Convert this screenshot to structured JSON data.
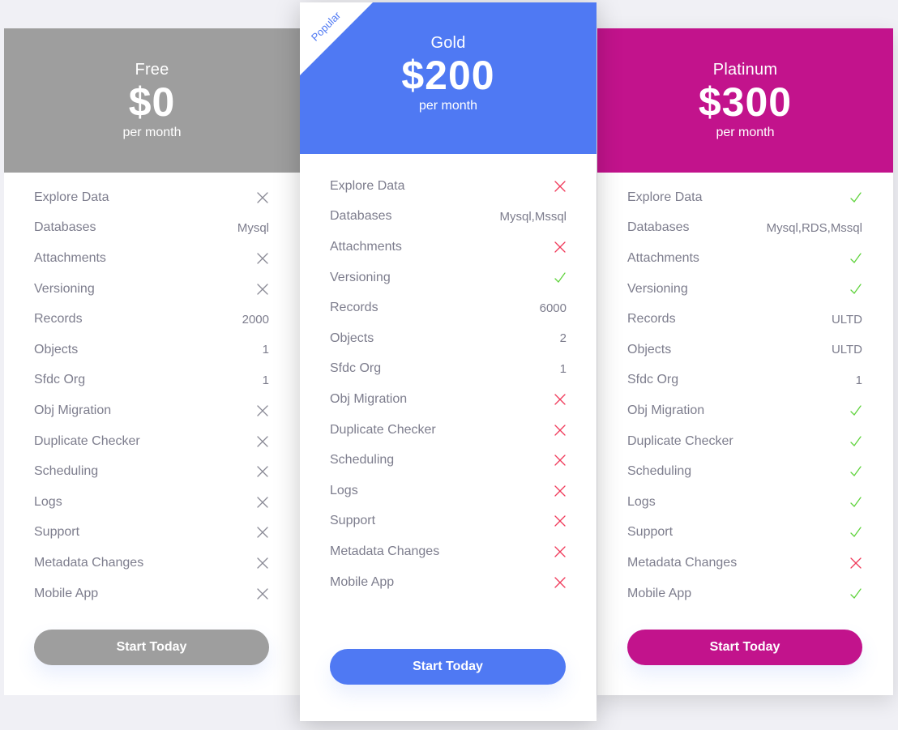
{
  "colors": {
    "free": "#9e9e9e",
    "gold": "#4f79f3",
    "platinum": "#c2138c",
    "check": "#5fd33c",
    "cross_red": "#f03a5a",
    "cross_gray": "#8a8a96"
  },
  "plans": [
    {
      "id": "free",
      "name": "Free",
      "price": "$0",
      "period": "per month",
      "badge": null,
      "cta": "Start Today",
      "features": [
        {
          "label": "Explore Data",
          "type": "cross"
        },
        {
          "label": "Databases",
          "type": "text",
          "value": "Mysql"
        },
        {
          "label": "Attachments",
          "type": "cross"
        },
        {
          "label": "Versioning",
          "type": "cross"
        },
        {
          "label": "Records",
          "type": "text",
          "value": "2000"
        },
        {
          "label": "Objects",
          "type": "text",
          "value": "1"
        },
        {
          "label": "Sfdc Org",
          "type": "text",
          "value": "1"
        },
        {
          "label": "Obj Migration",
          "type": "cross"
        },
        {
          "label": "Duplicate Checker",
          "type": "cross"
        },
        {
          "label": "Scheduling",
          "type": "cross"
        },
        {
          "label": "Logs",
          "type": "cross"
        },
        {
          "label": "Support",
          "type": "cross"
        },
        {
          "label": "Metadata Changes",
          "type": "cross"
        },
        {
          "label": "Mobile App",
          "type": "cross"
        }
      ]
    },
    {
      "id": "gold",
      "name": "Gold",
      "price": "$200",
      "period": "per month",
      "badge": "Popular",
      "cta": "Start Today",
      "features": [
        {
          "label": "Explore Data",
          "type": "cross"
        },
        {
          "label": "Databases",
          "type": "text",
          "value": "Mysql,Mssql"
        },
        {
          "label": "Attachments",
          "type": "cross"
        },
        {
          "label": "Versioning",
          "type": "check"
        },
        {
          "label": "Records",
          "type": "text",
          "value": "6000"
        },
        {
          "label": "Objects",
          "type": "text",
          "value": "2"
        },
        {
          "label": "Sfdc Org",
          "type": "text",
          "value": "1"
        },
        {
          "label": "Obj Migration",
          "type": "cross"
        },
        {
          "label": "Duplicate Checker",
          "type": "cross"
        },
        {
          "label": "Scheduling",
          "type": "cross"
        },
        {
          "label": "Logs",
          "type": "cross"
        },
        {
          "label": "Support",
          "type": "cross"
        },
        {
          "label": "Metadata Changes",
          "type": "cross"
        },
        {
          "label": "Mobile App",
          "type": "cross"
        }
      ]
    },
    {
      "id": "platinum",
      "name": "Platinum",
      "price": "$300",
      "period": "per month",
      "badge": null,
      "cta": "Start Today",
      "features": [
        {
          "label": "Explore Data",
          "type": "check"
        },
        {
          "label": "Databases",
          "type": "text",
          "value": "Mysql,RDS,Mssql"
        },
        {
          "label": "Attachments",
          "type": "check"
        },
        {
          "label": "Versioning",
          "type": "check"
        },
        {
          "label": "Records",
          "type": "text",
          "value": "ULTD"
        },
        {
          "label": "Objects",
          "type": "text",
          "value": "ULTD"
        },
        {
          "label": "Sfdc Org",
          "type": "text",
          "value": "1"
        },
        {
          "label": "Obj Migration",
          "type": "check"
        },
        {
          "label": "Duplicate Checker",
          "type": "check"
        },
        {
          "label": "Scheduling",
          "type": "check"
        },
        {
          "label": "Logs",
          "type": "check"
        },
        {
          "label": "Support",
          "type": "check"
        },
        {
          "label": "Metadata Changes",
          "type": "cross"
        },
        {
          "label": "Mobile App",
          "type": "check"
        }
      ]
    }
  ]
}
